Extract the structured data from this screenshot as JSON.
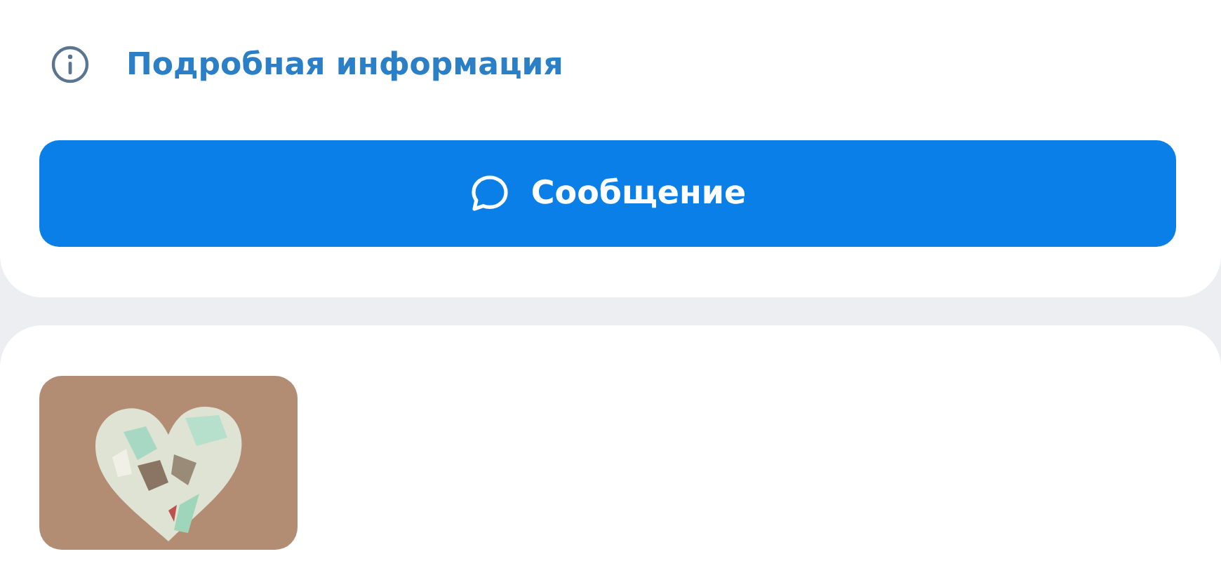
{
  "details_link": {
    "label": "Подробная информация"
  },
  "message_button": {
    "label": "Сообщение"
  }
}
